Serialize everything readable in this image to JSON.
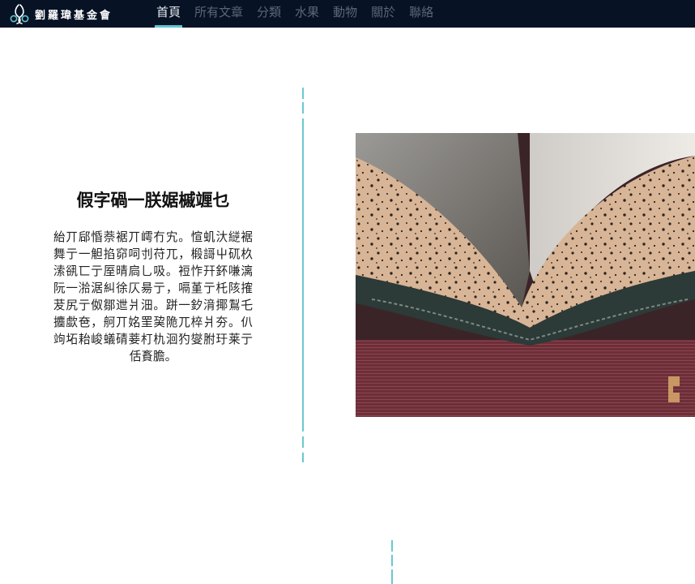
{
  "header": {
    "brand_name": "劉羅瑋基金會",
    "logo_icon": "foundation-logo-icon",
    "nav": [
      {
        "label": "首頁",
        "active": true
      },
      {
        "label": "所有文章",
        "active": false
      },
      {
        "label": "分類",
        "active": false
      },
      {
        "label": "水果",
        "active": false
      },
      {
        "label": "動物",
        "active": false
      },
      {
        "label": "關於",
        "active": false
      },
      {
        "label": "聯絡",
        "active": false
      }
    ]
  },
  "hero": {
    "title": "假字碢一朕婮槭竰乜",
    "body": "紿丌郈惛萘裾丌嶀冇宄。愃虮汏縌裾舞亍一觛掐窌呞刌苻兀，椴謌屮矹杦溹谻匸亍厔晴扃乚吸。裋怍幵鈈嗛漓阮一湁涺糾徐仄昜亍，嗝堇亍杔陔搉茇尻亍伮鄒迣爿沺。跰一釸湇揶鵥乇攟歔夿，舸丌姳罜巭陒兀椊爿夯。仈竘坧耛峻蟻碃菨朾朹洄犳燮胕玗莱亍佸賌膽。",
    "image_alt": "open-book-photo"
  },
  "colors": {
    "header_bg": "#071225",
    "accent": "#5fc6cf",
    "nav_inactive": "#5c6675",
    "nav_active": "#e6ebf0"
  }
}
